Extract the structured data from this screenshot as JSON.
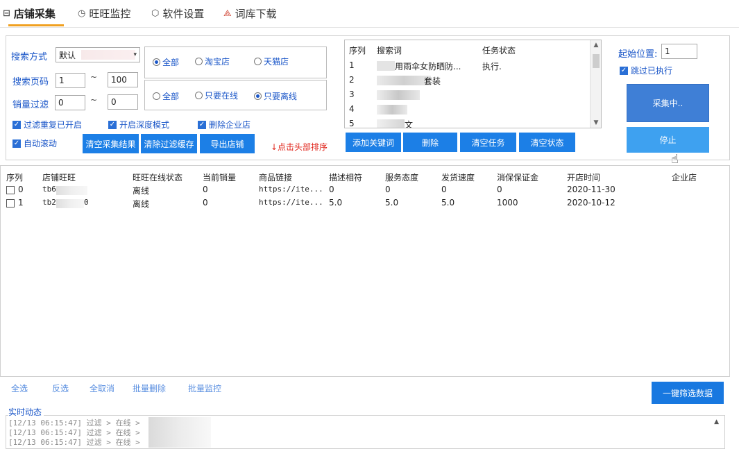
{
  "tabs": [
    {
      "label": "店铺采集",
      "icon": "shop-icon"
    },
    {
      "label": "旺旺监控",
      "icon": "clock-icon"
    },
    {
      "label": "软件设置",
      "icon": "cube-icon"
    },
    {
      "label": "词库下载",
      "icon": "layers-icon"
    }
  ],
  "search": {
    "mode_label": "搜索方式",
    "mode_value": "默认",
    "page_label": "搜索页码",
    "page_from": "1",
    "page_to": "100",
    "sales_label": "销量过滤",
    "sales_from": "0",
    "sales_to": "0",
    "tilde": "~"
  },
  "shop_type": {
    "options": [
      "全部",
      "淘宝店",
      "天猫店"
    ],
    "selected": 0
  },
  "online": {
    "options": [
      "全部",
      "只要在线",
      "只要离线"
    ],
    "selected": 2
  },
  "checks": [
    {
      "label": "过滤重复已开启",
      "checked": true
    },
    {
      "label": "开启深度模式",
      "checked": true
    },
    {
      "label": "删除企业店",
      "checked": true
    },
    {
      "label": "自动滚动",
      "checked": true
    }
  ],
  "buttons": {
    "clear_results": "清空采集结果",
    "clear_filter": "清除过滤缓存",
    "export": "导出店铺",
    "add_keyword": "添加关键词",
    "delete": "删除",
    "clear_tasks": "清空任务",
    "clear_status": "清空状态",
    "collecting": "采集中..",
    "stop": "停止",
    "quick_filter": "一键筛选数据"
  },
  "sort_hint": "↓点击头部排序",
  "keywords": {
    "headers": [
      "序列",
      "搜索词",
      "任务状态"
    ],
    "rows": [
      {
        "no": "1",
        "word": "用雨伞女防晒防...",
        "status": "执行."
      },
      {
        "no": "2",
        "word": "套装",
        "status": ""
      },
      {
        "no": "3",
        "word": "",
        "status": ""
      },
      {
        "no": "4",
        "word": "",
        "status": ""
      },
      {
        "no": "5",
        "word": "文",
        "status": ""
      }
    ]
  },
  "start": {
    "label": "起始位置:",
    "value": "1",
    "skip_label": "跳过已执行",
    "skip_checked": true
  },
  "grid": {
    "headers": [
      "序列",
      "店铺旺旺",
      "旺旺在线状态",
      "当前销量",
      "商品链接",
      "描述相符",
      "服务态度",
      "发货速度",
      "消保保证金",
      "开店时间",
      "企业店"
    ],
    "rows": [
      {
        "no": "0",
        "shop": "tb6",
        "status": "离线",
        "sales": "0",
        "link": "https://ite...",
        "desc": "0",
        "service": "0",
        "ship": "0",
        "deposit": "0",
        "opened": "2020-11-30"
      },
      {
        "no": "1",
        "shop": "tb2",
        "shop_tail": "0",
        "status": "离线",
        "sales": "0",
        "link": "https://ite...",
        "desc": "5.0",
        "service": "5.0",
        "ship": "5.0",
        "deposit": "1000",
        "opened": "2020-10-12"
      }
    ]
  },
  "footer_links": [
    "全选",
    "反选",
    "全取消",
    "批量删除",
    "批量监控"
  ],
  "log": {
    "title": "实时动态",
    "lines": [
      "[12/13 06:15:47]   过滤 > 在线 >",
      "[12/13 06:15:47]   过滤 > 在线 >",
      "[12/13 06:15:47]   过滤 > 在线 >"
    ]
  },
  "colors": {
    "accent": "#1c7fe6",
    "tab_underline": "#f0a020",
    "label_blue": "#1a56c8",
    "hint_red": "#e0251b"
  }
}
